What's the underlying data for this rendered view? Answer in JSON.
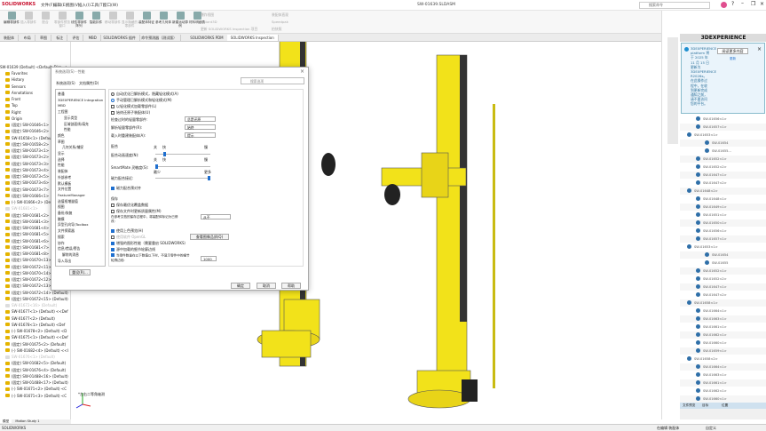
{
  "app": {
    "brand": "SOLIDWORKS",
    "title": "SW-01639.SLDASM",
    "search_placeholder": "搜索命令",
    "menus": [
      "文件(F)",
      "编辑(E)",
      "视图(V)",
      "插入(I)",
      "工具(T)",
      "窗口(W)"
    ]
  },
  "ribbon": {
    "buttons": [
      {
        "label": "编辑零部件",
        "enabled": true
      },
      {
        "label": "插入零部件",
        "enabled": false
      },
      {
        "label": "配合",
        "enabled": false
      },
      {
        "label": "零部件预览窗口",
        "enabled": false
      },
      {
        "label": "线性零部件阵列",
        "enabled": true
      },
      {
        "label": "智能扣件",
        "enabled": true
      },
      {
        "label": "移动零部件",
        "enabled": false
      },
      {
        "label": "显示隐藏的零部件",
        "enabled": false
      },
      {
        "label": "装配体特征",
        "enabled": true
      },
      {
        "label": "参考几何体",
        "enabled": true
      },
      {
        "label": "新建运动算例",
        "enabled": true
      },
      {
        "label": "材料明细表",
        "enabled": true
      }
    ],
    "small": [
      "爆炸视图",
      "Instant3D",
      "更新 SOLIDWORKS Inspection 项目",
      "装配体直观",
      "Speedpak",
      "拍快照"
    ]
  },
  "tabs": [
    "装配体",
    "布局",
    "草图",
    "标注",
    "评估",
    "MBD",
    "SOLIDWORKS 插件",
    "命令预测器（测试版）",
    "SOLIDWORKS PDM",
    "SOLIDWORKS Inspection"
  ],
  "tree": {
    "root": "SW-01639 (Default) <Default_Disp...>",
    "items": [
      {
        "t": "Favorites"
      },
      {
        "t": "History"
      },
      {
        "t": "Sensors"
      },
      {
        "t": "Annotations"
      },
      {
        "t": "Front"
      },
      {
        "t": "Top"
      },
      {
        "t": "Right"
      },
      {
        "t": "Origin"
      },
      {
        "t": "(固定) SW-01646<1>"
      },
      {
        "t": "(固定) SW-01646<2>"
      },
      {
        "t": "SW-01658<1> (Default)"
      },
      {
        "t": "(固定) SW-01658<2>"
      },
      {
        "t": "(固定) SW-01673<1>"
      },
      {
        "t": "(固定) SW-01673<2>"
      },
      {
        "t": "(固定) SW-01673<3>"
      },
      {
        "t": "(固定) SW-01673<4>"
      },
      {
        "t": "(固定) SW-01673<5>"
      },
      {
        "t": "(固定) SW-01673<6>"
      },
      {
        "t": "(固定) SW-01673<7>"
      },
      {
        "t": "(固定) SW-01666<1>"
      },
      {
        "t": "(-) SW-01666<2> (Def"
      },
      {
        "t": "SW-01681<1>",
        "g": true
      },
      {
        "t": "(固定) SW-01681<2>"
      },
      {
        "t": "(固定) SW-01681<3>"
      },
      {
        "t": "(固定) SW-01681<4>"
      },
      {
        "t": "(固定) SW-01681<5>"
      },
      {
        "t": "(固定) SW-01681<6>"
      },
      {
        "t": "(固定) SW-01681<7>"
      },
      {
        "t": "(固定) SW-01681<8>"
      },
      {
        "t": "(固定) SW-01670<13>"
      },
      {
        "t": "(固定) SW-01672<11>"
      },
      {
        "t": "(固定) SW-01670<14>"
      },
      {
        "t": "(固定) SW-01672<12>"
      },
      {
        "t": "(固定) SW-01672<13> (Default)"
      },
      {
        "t": "(固定) SW-01672<14> (Default)"
      },
      {
        "t": "(固定) SW-01672<15> (Default)"
      },
      {
        "t": "SW-01672<16> (Default)",
        "g": true
      },
      {
        "t": "SW-01677<1> (Default) <<Def"
      },
      {
        "t": "SW-01677<2> (Default)"
      },
      {
        "t": "SW-01678<1> (Default) <Def"
      },
      {
        "t": "(-) SW-01678<2> (Default) <D"
      },
      {
        "t": "SW-01675<1> (Default) <<Def"
      },
      {
        "t": "(固定) SW-01675<2> (Default)"
      },
      {
        "t": "(-) SW-01682<4> (Default) <<I"
      },
      {
        "t": "SW-01676<1> (Default)",
        "g": true
      },
      {
        "t": "(固定) SW-01682<5> (Default)"
      },
      {
        "t": "(固定) SW-01676<4> (Default)"
      },
      {
        "t": "(固定) SW-01488<16> (Default)"
      },
      {
        "t": "(固定) SW-01488<17> (Default)"
      },
      {
        "t": "(-) SW-01671<2> (Default) <C"
      },
      {
        "t": "(-) SW-01671<3> (Default) <C"
      }
    ]
  },
  "bottom_tabs": [
    "模型",
    "Motion Study 1"
  ],
  "viewport": {
    "view_label": "*左右二等角轴测"
  },
  "dialog": {
    "title": "系统选项(S) - 性能",
    "tab_system": "系统选项(S)",
    "tab_doc": "文档属性(D)",
    "search_placeholder": "搜索选项",
    "nav": [
      "普通",
      "3DEXPERIENCE Integration",
      "MBD",
      "工程图",
      "显示类型",
      "区域剖面线/填充",
      "性能",
      "颜色",
      "草图",
      "几何关系/捕捉",
      "显示",
      "选择",
      "性能",
      "装配体",
      "外部参考",
      "默认模板",
      "文件位置",
      "FeatureManager",
      "选值框增量值",
      "视图",
      "备份/恢复",
      "触摸",
      "异型孔向导/Toolbox",
      "文件探索器",
      "搜索",
      "协作",
      "信息/错误/警告",
      "解除的消息",
      "导入导出"
    ],
    "reset": "重设(R)...",
    "radio_auto": "自动优化已解析模式，隐藏轻化模式(A)",
    "radio_manual": "手动管理已解析模式和轻化模式(M)",
    "cb_lightweight": "以轻化模式加载零部件(L)",
    "cb_restore": "始终还原子装配体(U)",
    "check_outdated": "检查过时的轻量零部件:",
    "check_outdated_val": "总是还原",
    "resolve": "解析轻量零部件(R):",
    "resolve_val": "始终",
    "rebuild": "载入时重建装配体(A):",
    "rebuild_val": "提示",
    "mates": "配合",
    "mate_anim": "配合动画速度(N):",
    "smartmate": "SmartMate 灵敏度(S):",
    "magnetic": "磁力配合接近:",
    "off": "关",
    "fast": "快",
    "slow": "慢",
    "least": "最少",
    "more": "更多",
    "slider_values": {
      "mate_anim": 0.15,
      "smartmate": 0.0,
      "magnetic": 1.0
    },
    "cb_prealign": "磁力配合预对齐",
    "save": "保存",
    "cb_save_opt": "保存最优化覆盖数据",
    "cb_save_mass": "保存文件时更新质量属性(M)",
    "mark_modified": "在参考文档的保存过程中，将装配体标记为已修改:",
    "mark_modified_val": "从不",
    "cb_shaded": "使用上色预览(H)",
    "cb_opengl": "使用软件 OpenGL",
    "image_quality": "查看图像品质(Q)",
    "cb_enhanced": "增强的图形性能（需要重启 SOLIDWORKS）",
    "cb_silhouette": "源中加载的细节轮廓边线",
    "cb_threshold": "当零件数量在以下数值以下时，不显示零件中的细节轮廓边线:",
    "threshold_val": "1000",
    "ok": "确定",
    "cancel": "取消",
    "help": "帮助"
  },
  "rpanel": {
    "header": "3DEXPERIENCE",
    "notice": "3DEXPERIENCE platform 将于 2025 年 11 月 15 日更新为 3DEXPERIENCE R2026x。在此操作过程中，在收到更新完成通知之前，请不要访问您的平台。",
    "read_more": "阅读更多内容",
    "update": "更新",
    "items": [
      {
        "t": "SW-01656<1>",
        "l": 1
      },
      {
        "t": "SW-01657<1>",
        "l": 1
      },
      {
        "t": "SW-01653<1>",
        "l": 0
      },
      {
        "t": "SW-01654",
        "l": 2
      },
      {
        "t": "SW-01655...",
        "l": 2
      },
      {
        "t": "SW-01652<1>",
        "l": 1
      },
      {
        "t": "SW-01652<2>",
        "l": 1
      },
      {
        "t": "SW-01647<1>",
        "l": 1
      },
      {
        "t": "SW-01647<2>",
        "l": 1
      },
      {
        "t": "SW-01648<2>",
        "l": 0
      },
      {
        "t": "SW-01648<1>",
        "l": 1
      },
      {
        "t": "SW-01649<1>",
        "l": 1
      },
      {
        "t": "SW-01651<1>",
        "l": 1
      },
      {
        "t": "SW-01650<1>",
        "l": 1
      },
      {
        "t": "SW-01656<1>",
        "l": 1
      },
      {
        "t": "SW-01657<1>",
        "l": 1
      },
      {
        "t": "SW-01653<1>",
        "l": 0
      },
      {
        "t": "SW-01654",
        "l": 2
      },
      {
        "t": "SW-01655",
        "l": 2
      },
      {
        "t": "SW-01652<1>",
        "l": 1
      },
      {
        "t": "SW-01652<2>",
        "l": 1
      },
      {
        "t": "SW-01647<1>",
        "l": 1
      },
      {
        "t": "SW-01647<2>",
        "l": 1
      },
      {
        "t": "SW-01658<1>",
        "l": 0
      },
      {
        "t": "SW-01664<1>",
        "l": 1
      },
      {
        "t": "SW-01663<1>",
        "l": 1
      },
      {
        "t": "SW-01661<1>",
        "l": 1
      },
      {
        "t": "SW-01662<1>",
        "l": 1
      },
      {
        "t": "SW-01660<1>",
        "l": 1
      },
      {
        "t": "SW-01659<1>",
        "l": 1
      },
      {
        "t": "SW-01658<2>",
        "l": 0
      },
      {
        "t": "SW-01664<1>",
        "l": 1
      },
      {
        "t": "SW-01663<1>",
        "l": 1
      },
      {
        "t": "SW-01661<1>",
        "l": 1
      },
      {
        "t": "SW-01662<1>",
        "l": 1
      },
      {
        "t": "SW-01660<1>",
        "l": 1
      }
    ],
    "tabs": [
      "文件预览",
      "目标",
      "位置"
    ]
  },
  "status": {
    "left": "SOLIDWORKS",
    "mode": "在编辑 装配体",
    "custom": "自定义"
  },
  "colors": {
    "accent": "#1f6fcf",
    "model_yellow": "#f2e21a",
    "brand_red": "#c8102e"
  }
}
